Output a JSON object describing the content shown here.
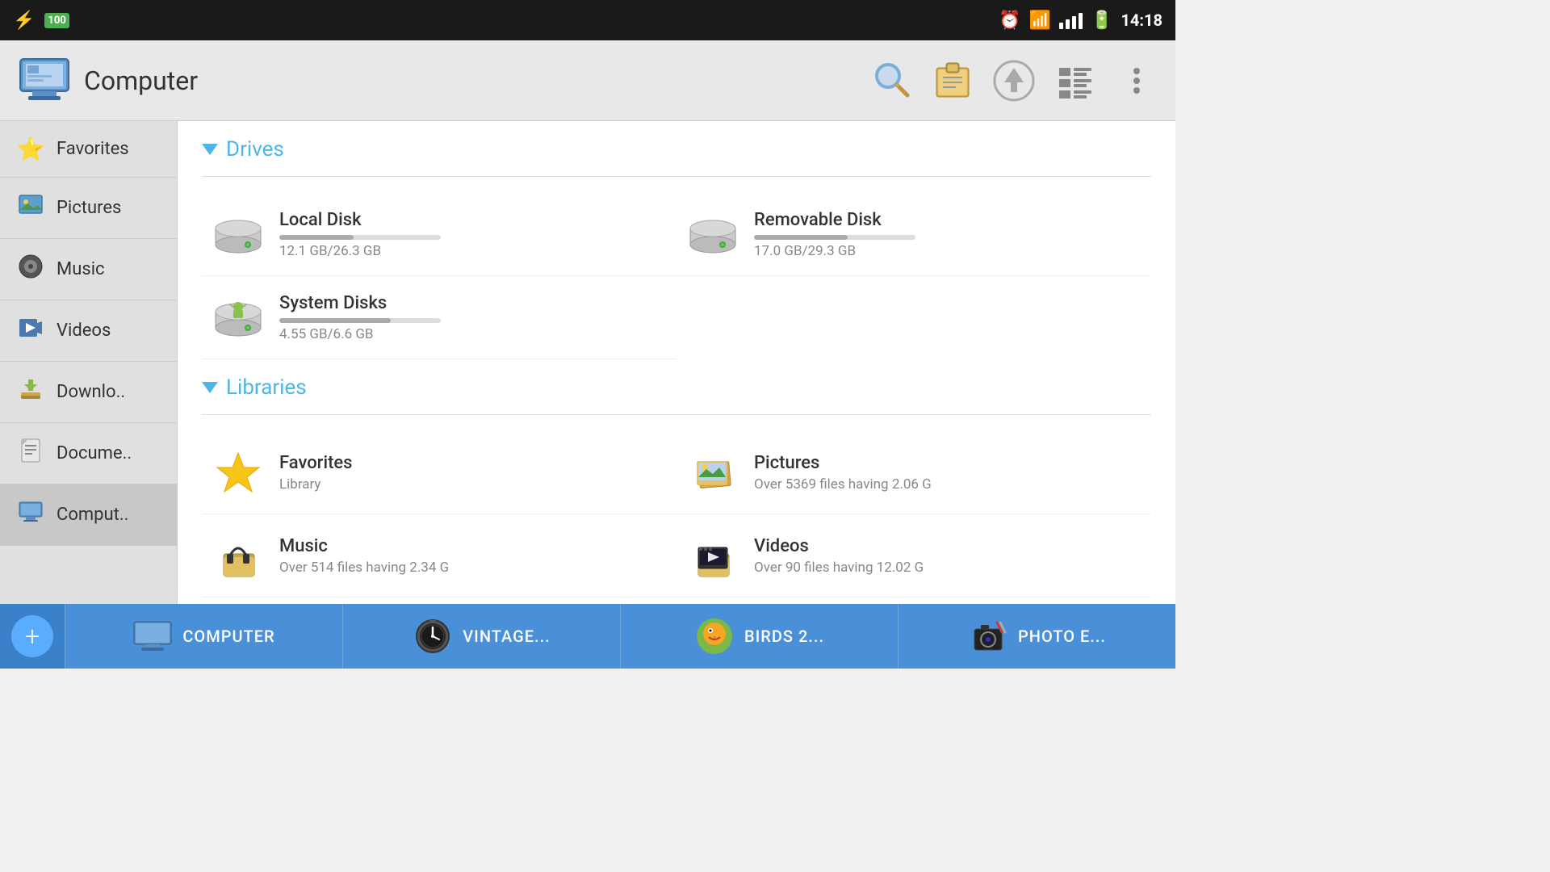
{
  "statusBar": {
    "time": "14:18",
    "batteryLevel": "100"
  },
  "toolbar": {
    "appTitle": "Computer"
  },
  "sidebar": {
    "items": [
      {
        "id": "favorites",
        "label": "Favorites",
        "icon": "⭐"
      },
      {
        "id": "pictures",
        "label": "Pictures",
        "icon": "🖼"
      },
      {
        "id": "music",
        "label": "Music",
        "icon": "🔒"
      },
      {
        "id": "videos",
        "label": "Videos",
        "icon": "🎬"
      },
      {
        "id": "downloads",
        "label": "Downlo..",
        "icon": "📥"
      },
      {
        "id": "documents",
        "label": "Docume..",
        "icon": "📄"
      },
      {
        "id": "computer",
        "label": "Comput..",
        "icon": "💻"
      }
    ]
  },
  "sections": {
    "drives": {
      "title": "Drives",
      "items": [
        {
          "id": "local-disk",
          "name": "Local Disk",
          "detail": "12.1 GB/26.3 GB",
          "progress": 46
        },
        {
          "id": "removable-disk",
          "name": "Removable Disk",
          "detail": "17.0 GB/29.3 GB",
          "progress": 58
        },
        {
          "id": "system-disks",
          "name": "System Disks",
          "detail": "4.55 GB/6.6 GB",
          "progress": 69
        }
      ]
    },
    "libraries": {
      "title": "Libraries",
      "items": [
        {
          "id": "favorites-lib",
          "name": "Favorites",
          "detail": "Library",
          "icon": "star"
        },
        {
          "id": "pictures-lib",
          "name": "Pictures",
          "detail": "Over 5369 files having 2.06 G",
          "icon": "pictures"
        },
        {
          "id": "music-lib",
          "name": "Music",
          "detail": "Over 514 files having 2.34 G",
          "icon": "music"
        },
        {
          "id": "videos-lib",
          "name": "Videos",
          "detail": "Over 90 files having 12.02 G",
          "icon": "videos"
        }
      ]
    }
  },
  "taskbar": {
    "addLabel": "+",
    "items": [
      {
        "id": "computer",
        "label": "COMPUTER",
        "icon": "computer"
      },
      {
        "id": "vintage",
        "label": "VINTAGE...",
        "icon": "clock"
      },
      {
        "id": "birds",
        "label": "BIRDS 2...",
        "icon": "birds"
      },
      {
        "id": "photo",
        "label": "PHOTO E...",
        "icon": "photo"
      }
    ]
  }
}
